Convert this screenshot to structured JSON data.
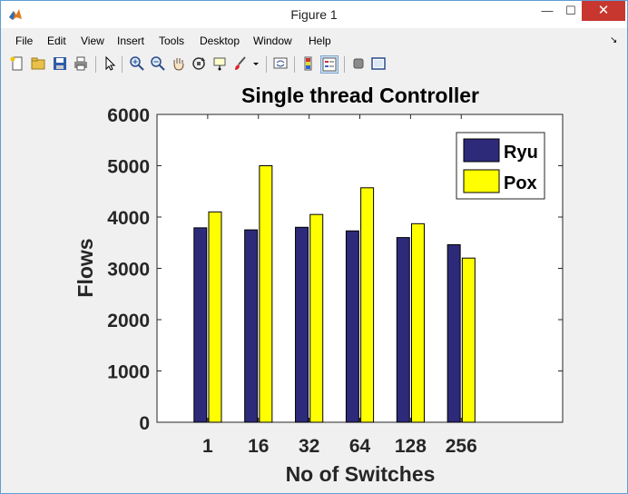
{
  "window": {
    "title": "Figure 1",
    "min_glyph": "—",
    "max_glyph": "☐",
    "close_glyph": "✕"
  },
  "menu": {
    "items": [
      "File",
      "Edit",
      "View",
      "Insert",
      "Tools",
      "Desktop",
      "Window",
      "Help"
    ],
    "dock_glyph": "↘"
  },
  "toolbar": {
    "icons": [
      "new-figure-icon",
      "open-file-icon",
      "save-icon",
      "print-icon",
      "edit-plot-arrow-icon",
      "zoom-in-icon",
      "zoom-out-icon",
      "pan-hand-icon",
      "rotate-3d-icon",
      "data-cursor-icon",
      "brush-icon",
      "link-plot-icon",
      "colorbar-icon",
      "legend-icon",
      "hide-plot-tools-icon",
      "show-plot-tools-icon"
    ]
  },
  "chart_data": {
    "type": "bar",
    "title": "Single thread Controller",
    "xlabel": "No of Switches",
    "ylabel": "Flows",
    "categories": [
      "1",
      "16",
      "32",
      "64",
      "128",
      "256"
    ],
    "series": [
      {
        "name": "Ryu",
        "color": "#2e2a7a",
        "values": [
          3790,
          3750,
          3800,
          3730,
          3600,
          3460
        ]
      },
      {
        "name": "Pox",
        "color": "#ffff00",
        "values": [
          4100,
          5000,
          4050,
          4570,
          3870,
          3200
        ]
      }
    ],
    "ylim": [
      0,
      6000
    ],
    "yticks": [
      0,
      1000,
      2000,
      3000,
      4000,
      5000,
      6000
    ],
    "xlim": [
      0,
      8
    ],
    "legend": "top-right",
    "grid": false
  }
}
